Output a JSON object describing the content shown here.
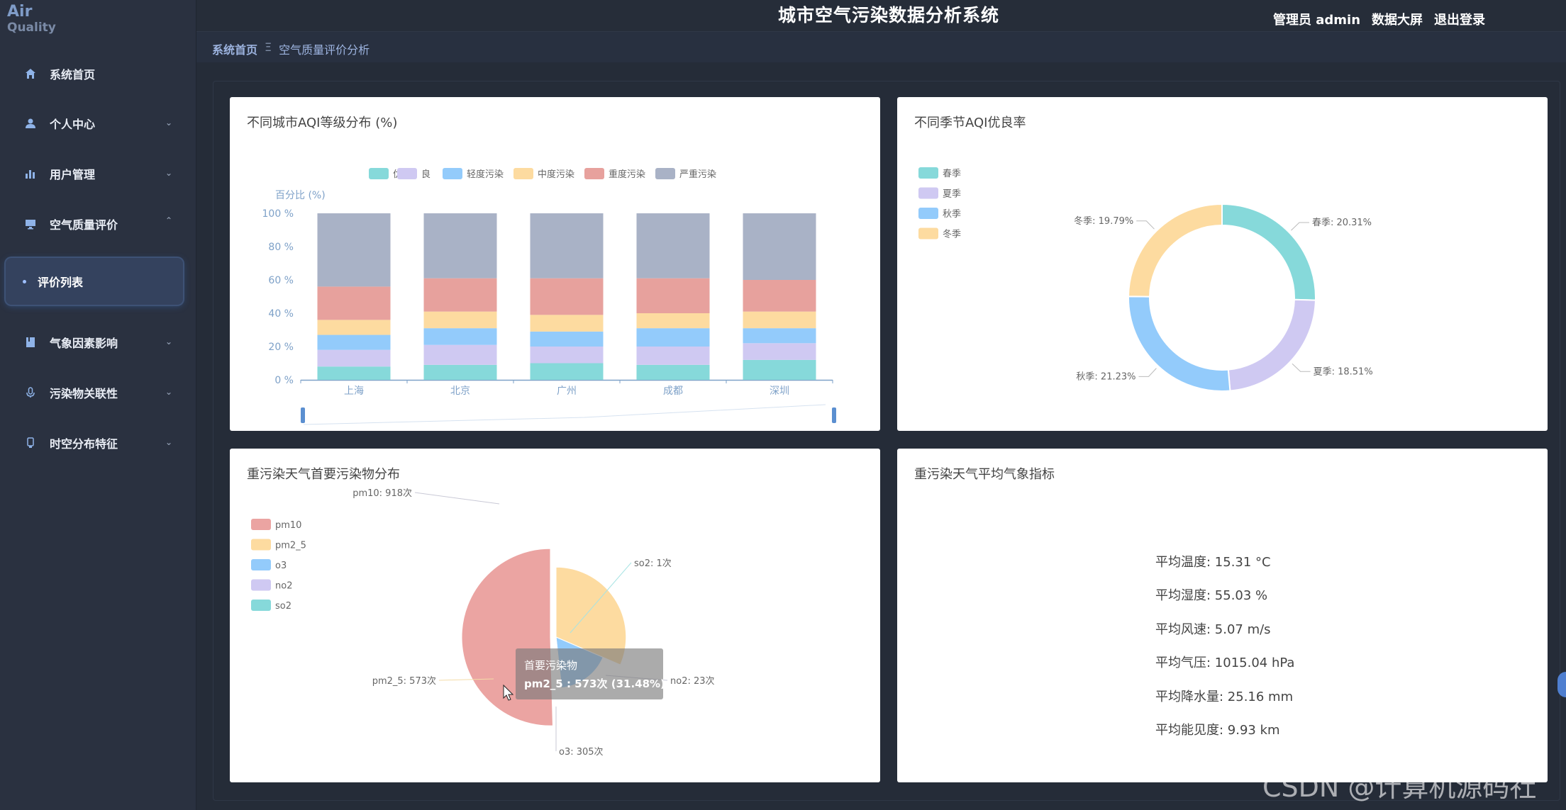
{
  "app": {
    "logo_line1": "Air",
    "logo_line2": "Quality",
    "title": "城市空气污染数据分析系统"
  },
  "header": {
    "user": "管理员 admin",
    "dashboard": "数据大屏",
    "logout": "退出登录"
  },
  "breadcrumb": {
    "home": "系统首页",
    "sep": "Ξ",
    "current": "空气质量评价分析"
  },
  "sidebar": {
    "items": [
      {
        "label": "系统首页",
        "icon": "home-icon"
      },
      {
        "label": "个人中心",
        "icon": "user-icon",
        "expanded": false
      },
      {
        "label": "用户管理",
        "icon": "bar-chart-icon",
        "expanded": false
      },
      {
        "label": "空气质量评价",
        "icon": "monitor-icon",
        "expanded": true
      },
      {
        "label": "气象因素影响",
        "icon": "book-icon",
        "expanded": false
      },
      {
        "label": "污染物关联性",
        "icon": "microphone-icon",
        "expanded": false
      },
      {
        "label": "时空分布特征",
        "icon": "device-icon",
        "expanded": false
      }
    ],
    "active_sub": "评价列表"
  },
  "cards": {
    "c1_title": "不同城市AQI等级分布 (%)",
    "c2_title": "不同季节AQI优良率",
    "c3_title": "重污染天气首要污染物分布",
    "c4_title": "重污染天气平均气象指标"
  },
  "colors": {
    "you": "#86d9da",
    "liang": "#cfc9f2",
    "qingdu": "#93cbfb",
    "zhongdu": "#fddba0",
    "zhongdu2": "#e7a19d",
    "yanzhong": "#a9b2c6"
  },
  "chart_data": [
    {
      "type": "bar",
      "stacked": true,
      "title": "不同城市AQI等级分布 (%)",
      "ylabel": "百分比 (%)",
      "ylim": [
        0,
        100
      ],
      "yticks": [
        "0 %",
        "20 %",
        "40 %",
        "60 %",
        "80 %",
        "100 %"
      ],
      "categories": [
        "上海",
        "北京",
        "广州",
        "成都",
        "深圳"
      ],
      "series": [
        {
          "name": "优",
          "color": "#86d9da",
          "values": [
            8,
            9,
            10,
            9,
            12
          ]
        },
        {
          "name": "良",
          "color": "#cfc9f2",
          "values": [
            10,
            12,
            10,
            11,
            10
          ]
        },
        {
          "name": "轻度污染",
          "color": "#93cbfb",
          "values": [
            9,
            10,
            9,
            11,
            9
          ]
        },
        {
          "name": "中度污染",
          "color": "#fddba0",
          "values": [
            9,
            10,
            10,
            9,
            10
          ]
        },
        {
          "name": "重度污染",
          "color": "#e7a19d",
          "values": [
            20,
            20,
            22,
            21,
            19
          ]
        },
        {
          "name": "严重污染",
          "color": "#a9b2c6",
          "values": [
            44,
            39,
            39,
            39,
            40
          ]
        }
      ],
      "legend": "top",
      "datazoom": true
    },
    {
      "type": "pie",
      "donut": true,
      "title": "不同季节AQI优良率",
      "legend": "top-left",
      "slices": [
        {
          "name": "春季",
          "value": 20.31,
          "label": "春季: 20.31%",
          "color": "#86d9da"
        },
        {
          "name": "夏季",
          "value": 18.51,
          "label": "夏季: 18.51%",
          "color": "#cfc9f2"
        },
        {
          "name": "秋季",
          "value": 21.23,
          "label": "秋季: 21.23%",
          "color": "#93cbfb"
        },
        {
          "name": "冬季",
          "value": 19.79,
          "label": "冬季: 19.79%",
          "color": "#fddba0"
        }
      ]
    },
    {
      "type": "pie",
      "rose": true,
      "title": "重污染天气首要污染物分布",
      "legend": "top-left",
      "slices": [
        {
          "name": "pm10",
          "value": 918,
          "label": "pm10: 918次",
          "color": "#eba4a2"
        },
        {
          "name": "pm2_5",
          "value": 573,
          "label": "pm2_5: 573次",
          "color": "#fddba0"
        },
        {
          "name": "o3",
          "value": 305,
          "label": "o3: 305次",
          "color": "#93cbfb"
        },
        {
          "name": "no2",
          "value": 23,
          "label": "no2: 23次",
          "color": "#cfc9f2"
        },
        {
          "name": "so2",
          "value": 1,
          "label": "so2: 1次",
          "color": "#86d9da"
        }
      ],
      "tooltip": {
        "title": "首要污染物",
        "text": "pm2_5 : 573次 (31.48%)"
      }
    }
  ],
  "metrics": [
    "平均温度: 15.31 °C",
    "平均湿度: 55.03 %",
    "平均风速: 5.07 m/s",
    "平均气压: 1015.04 hPa",
    "平均降水量: 25.16 mm",
    "平均能见度: 9.93 km"
  ],
  "watermark": "CSDN @计算机源码社"
}
